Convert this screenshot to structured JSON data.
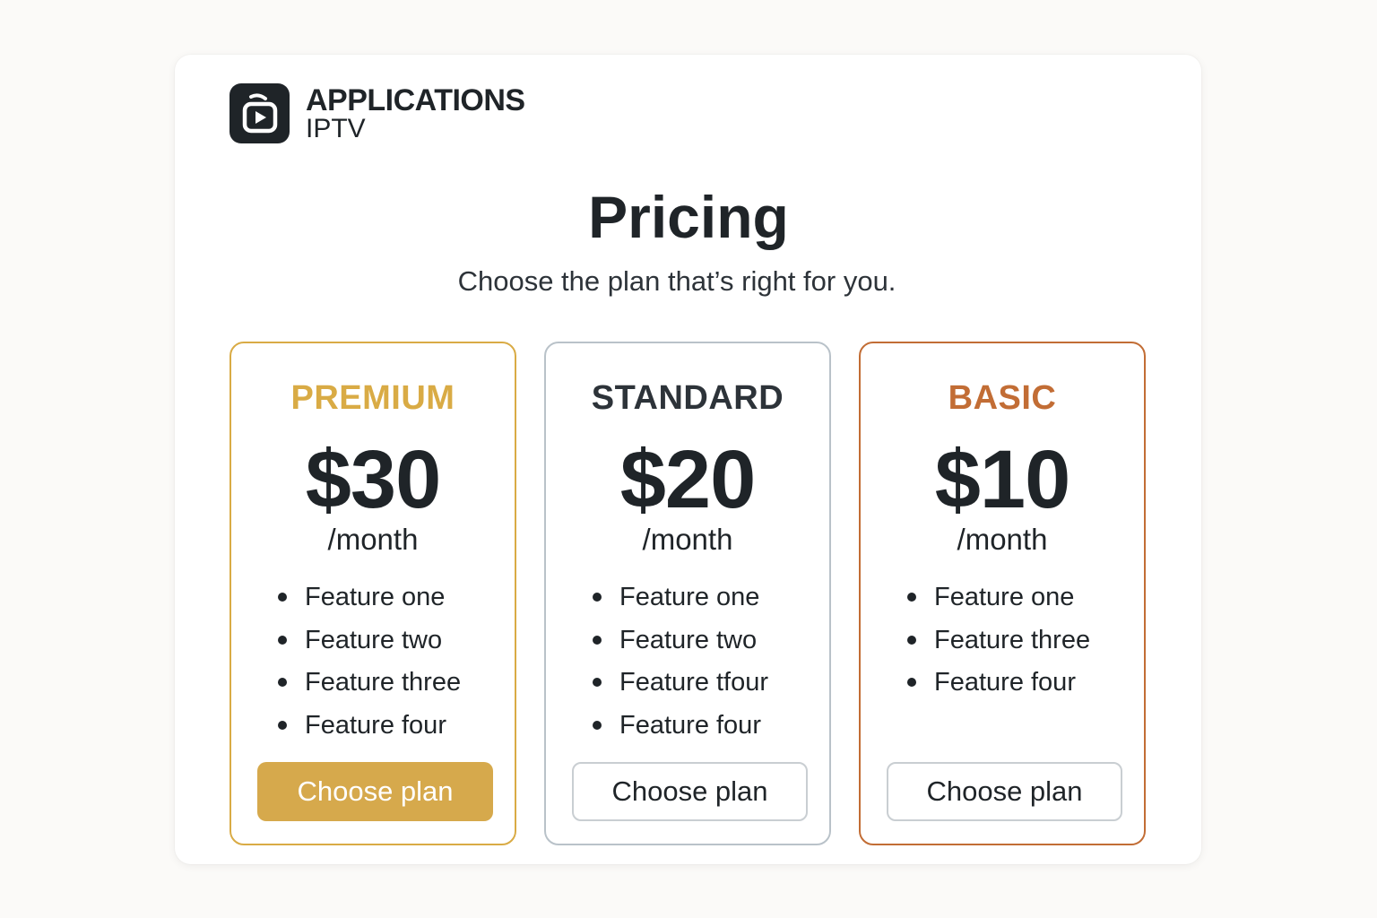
{
  "brand": {
    "name": "APPLICATIONS",
    "subtitle": "IPTV",
    "logo_icon": "tv-play-icon"
  },
  "header": {
    "title": "Pricing",
    "subtitle": "Choose the plan that’s right for you."
  },
  "colors": {
    "premium": "#d9ab45",
    "standard": "#b9c2c9",
    "basic": "#c26d35",
    "premium_button": "#d6a94c",
    "text": "#1f2428"
  },
  "plans": [
    {
      "name": "PREMIUM",
      "price": "$30",
      "period": "/month",
      "features": [
        "Feature one",
        "Feature two",
        "Feature three",
        "Feature four"
      ],
      "button_label": "Choose plan"
    },
    {
      "name": "STANDARD",
      "price": "$20",
      "period": "/month",
      "features": [
        "Feature one",
        "Feature two",
        "Feature tfour",
        "Feature four"
      ],
      "button_label": "Choose plan"
    },
    {
      "name": "BASIC",
      "price": "$10",
      "period": "/month",
      "features": [
        "Feature one",
        "Feature three",
        "Feature four"
      ],
      "button_label": "Choose plan"
    }
  ]
}
